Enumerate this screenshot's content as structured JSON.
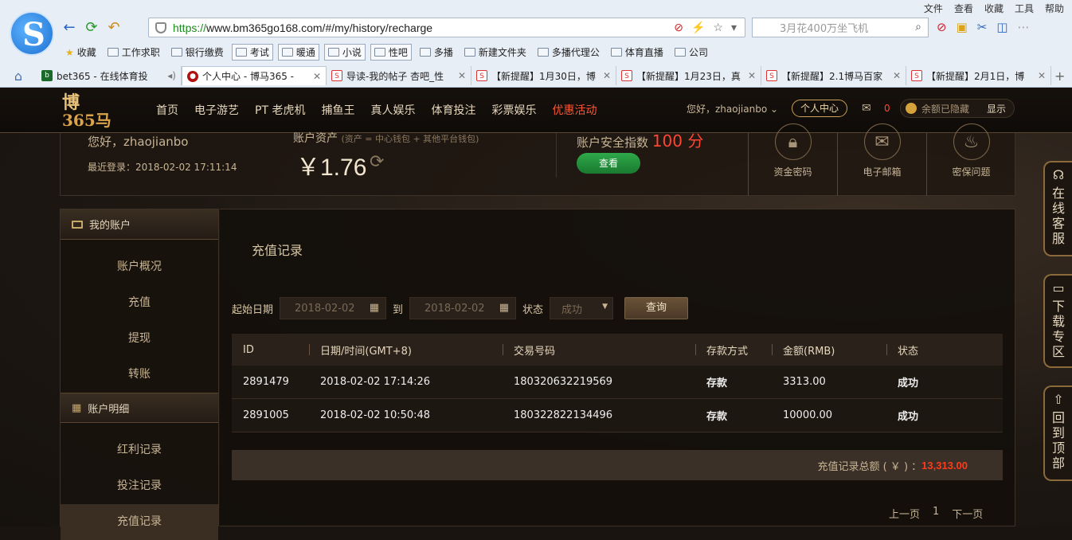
{
  "browser": {
    "menu": [
      "文件",
      "查看",
      "收藏",
      "工具",
      "帮助"
    ],
    "url_scheme": "https://",
    "url_rest": "www.bm365go168.com/#/my/history/recharge",
    "search_placeholder": "3月花400万坐飞机",
    "favorites": [
      "收藏",
      "工作求职",
      "银行缴费",
      "考试",
      "暖通",
      "小说",
      "性吧",
      "多播",
      "新建文件夹",
      "多播代理公",
      "体育直播",
      "公司"
    ],
    "tabs": [
      {
        "label": "bet365 - 在线体育投",
        "icon": "bet365"
      },
      {
        "label": "个人中心 - 博马365 - ",
        "icon": "site"
      },
      {
        "label": "导读-我的帖子 杏吧_性",
        "icon": "s"
      },
      {
        "label": "【新提醒】1月30日，博",
        "icon": "s"
      },
      {
        "label": "【新提醒】1月23日，真",
        "icon": "s"
      },
      {
        "label": "【新提醒】2.1博马百家",
        "icon": "s"
      },
      {
        "label": "【新提醒】2月1日，博",
        "icon": "s"
      }
    ]
  },
  "site": {
    "brand_top": "博",
    "brand_bottom": "365马",
    "nav": [
      "首页",
      "电子游艺",
      "PT 老虎机",
      "捕鱼王",
      "真人娱乐",
      "体育投注",
      "彩票娱乐",
      "优惠活动"
    ],
    "greeting_user": "您好，zhaojianbo",
    "personal_center": "个人中心",
    "mail_count": "0",
    "balance_hidden": "余额已隐藏",
    "show": "显示"
  },
  "account": {
    "hello": "您好，zhaojianbo",
    "last_login": "最近登录：2018-02-02 17:11:14",
    "asset_label": "账户资产",
    "asset_note": "(资产 = 中心钱包 + 其他平台钱包)",
    "balance": "￥1.76",
    "security_label": "账户安全指数",
    "security_score": "100 分",
    "check_btn": "查看",
    "quick": [
      {
        "label": "资金密码",
        "icon": "lock-icon"
      },
      {
        "label": "电子邮箱",
        "icon": "mail-icon"
      },
      {
        "label": "密保问题",
        "icon": "bulb-icon"
      }
    ]
  },
  "sidebar": {
    "my_account": "我的账户",
    "account_items": [
      "账户概况",
      "充值",
      "提现",
      "转账"
    ],
    "detail": "账户明细",
    "detail_items": [
      "红利记录",
      "投注记录",
      "充值记录"
    ]
  },
  "main": {
    "title": "充值记录",
    "start_label": "起始日期",
    "start_date": "2018-02-02",
    "to_label": "到",
    "end_date": "2018-02-02",
    "status_label": "状态",
    "status_value": "成功",
    "query_btn": "查询",
    "columns": [
      "ID",
      "日期/时间(GMT+8)",
      "交易号码",
      "存款方式",
      "金额(RMB)",
      "状态"
    ],
    "rows": [
      [
        "2891479",
        "2018-02-02 17:14:26",
        "180320632219569",
        "存款",
        "3313.00",
        "成功"
      ],
      [
        "2891005",
        "2018-02-02 10:50:48",
        "180322822134496",
        "存款",
        "10000.00",
        "成功"
      ]
    ],
    "total_label": "充值记录总额 ( ￥ ) ：",
    "total_value": "13,313.00",
    "prev": "上一页",
    "page": "1",
    "next": "下一页"
  },
  "float": [
    {
      "label": "在线客服",
      "icon": "headset-icon"
    },
    {
      "label": "下载专区",
      "icon": "monitor-icon"
    },
    {
      "label": "回到顶部",
      "icon": "rocket-icon"
    }
  ]
}
